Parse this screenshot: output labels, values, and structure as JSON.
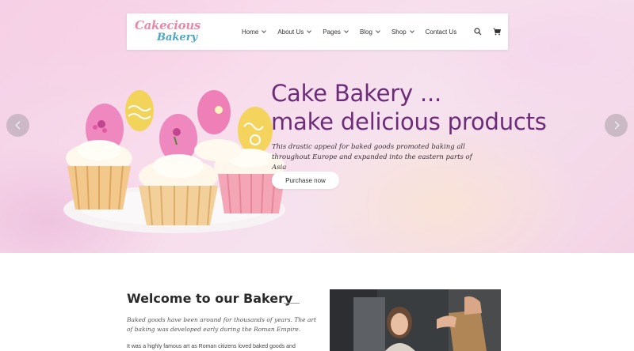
{
  "logo": {
    "line1": "Cakecious",
    "line2": "Bakery"
  },
  "nav": {
    "items": [
      {
        "label": "Home",
        "dropdown": true
      },
      {
        "label": "About Us",
        "dropdown": true
      },
      {
        "label": "Pages",
        "dropdown": true
      },
      {
        "label": "Blog",
        "dropdown": true
      },
      {
        "label": "Shop",
        "dropdown": true
      },
      {
        "label": "Contact Us",
        "dropdown": false
      }
    ],
    "icons": [
      "search-icon",
      "cart-icon"
    ]
  },
  "hero": {
    "title_line1": "Cake Bakery ...",
    "title_line2": "make delicious products",
    "description": "This drastic appeal for baked goods promoted baking all throughout Europe and expanded into the eastern parts of Asia",
    "button": "Purchase now",
    "title_color": "#6c2c79"
  },
  "welcome": {
    "title": "Welcome to our Bakery",
    "intro": "Baked goods have been around for thousands of years. The art of baking was developed early during the Roman Empire.",
    "body": "It was a highly famous art as Roman citizens loved baked goods and"
  }
}
